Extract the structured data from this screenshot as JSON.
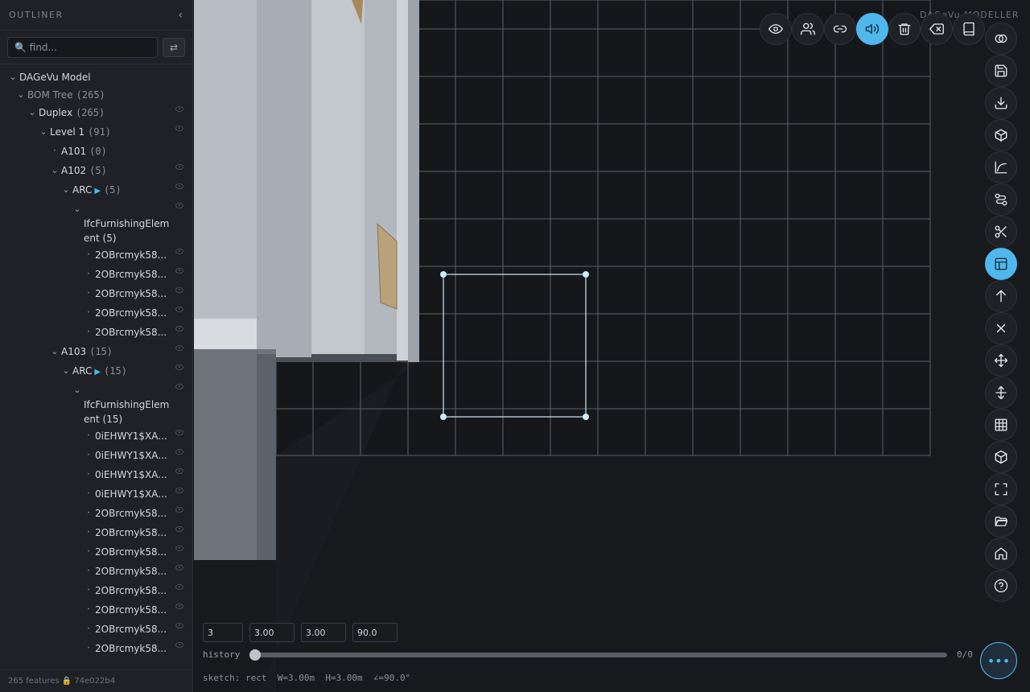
{
  "sidebar": {
    "title": "OUTLINER",
    "search_placeholder": "🔍 find...",
    "swap_icon": "⇄",
    "footer": "265 features 🔒 74e022b4"
  },
  "tree": [
    {
      "label": "DAGeVu Model",
      "count": "",
      "level": 0,
      "chev": true,
      "eye": false
    },
    {
      "label": "BOM Tree",
      "count": "(265)",
      "level": 1,
      "chev": true,
      "eye": false,
      "muted": true
    },
    {
      "label": "Duplex",
      "count": "(265)",
      "level": 2,
      "chev": true,
      "eye": true
    },
    {
      "label": "Level 1",
      "count": "(91)",
      "level": 3,
      "chev": true,
      "eye": true
    },
    {
      "label": "A101",
      "count": "(0)",
      "level": 4,
      "chev": false,
      "eye": false
    },
    {
      "label": "A102",
      "count": "(5)",
      "level": 4,
      "chev": true,
      "eye": true
    },
    {
      "label": "ARC",
      "count": "(5)",
      "level": 5,
      "chev": true,
      "eye": true,
      "arrow": true
    },
    {
      "label": "IfcFurnishingElement (5)",
      "count": "",
      "level": 6,
      "chev": true,
      "eye": true,
      "wrap": true
    },
    {
      "label": "2OBrcmyk58...",
      "count": "",
      "level": 7,
      "chev": false,
      "eye": true
    },
    {
      "label": "2OBrcmyk58...",
      "count": "",
      "level": 7,
      "chev": false,
      "eye": true
    },
    {
      "label": "2OBrcmyk58...",
      "count": "",
      "level": 7,
      "chev": false,
      "eye": true
    },
    {
      "label": "2OBrcmyk58...",
      "count": "",
      "level": 7,
      "chev": false,
      "eye": true
    },
    {
      "label": "2OBrcmyk58...",
      "count": "",
      "level": 7,
      "chev": false,
      "eye": true
    },
    {
      "label": "A103",
      "count": "(15)",
      "level": 4,
      "chev": true,
      "eye": true
    },
    {
      "label": "ARC",
      "count": "(15)",
      "level": 5,
      "chev": true,
      "eye": true,
      "arrow": true
    },
    {
      "label": "IfcFurnishingElement (15)",
      "count": "",
      "level": 6,
      "chev": true,
      "eye": true,
      "wrap": true
    },
    {
      "label": "0iEHWY1$XA...",
      "count": "",
      "level": 7,
      "chev": false,
      "eye": true
    },
    {
      "label": "0iEHWY1$XA...",
      "count": "",
      "level": 7,
      "chev": false,
      "eye": true
    },
    {
      "label": "0iEHWY1$XA...",
      "count": "",
      "level": 7,
      "chev": false,
      "eye": true
    },
    {
      "label": "0iEHWY1$XA...",
      "count": "",
      "level": 7,
      "chev": false,
      "eye": true
    },
    {
      "label": "2OBrcmyk58...",
      "count": "",
      "level": 7,
      "chev": false,
      "eye": true
    },
    {
      "label": "2OBrcmyk58...",
      "count": "",
      "level": 7,
      "chev": false,
      "eye": true
    },
    {
      "label": "2OBrcmyk58...",
      "count": "",
      "level": 7,
      "chev": false,
      "eye": true
    },
    {
      "label": "2OBrcmyk58...",
      "count": "",
      "level": 7,
      "chev": false,
      "eye": true
    },
    {
      "label": "2OBrcmyk58...",
      "count": "",
      "level": 7,
      "chev": false,
      "eye": true
    },
    {
      "label": "2OBrcmyk58...",
      "count": "",
      "level": 7,
      "chev": false,
      "eye": true
    },
    {
      "label": "2OBrcmyk58...",
      "count": "",
      "level": 7,
      "chev": false,
      "eye": true
    },
    {
      "label": "2OBrcmyk58...",
      "count": "",
      "level": 7,
      "chev": false,
      "eye": true
    }
  ],
  "viewport": {
    "brand": "DAGeVu MODELLER"
  },
  "top_toolbar": [
    "eye-icon",
    "users-icon",
    "link-icon",
    "volume-icon",
    "trash-icon",
    "backspace-icon",
    "book-icon"
  ],
  "right_toolbar": [
    "overlap-circles-icon",
    "save-icon",
    "download-icon",
    "box-icon",
    "curve-icon",
    "route-icon",
    "scissors-icon",
    "layout-icon",
    "arrow-up-icon",
    "close-icon",
    "move-icon",
    "split-vertical-icon",
    "grid-icon",
    "cube-icon",
    "fullscreen-icon",
    "folder-open-icon",
    "home-icon",
    "help-icon"
  ],
  "accent": "#4fb7ec",
  "controls": {
    "count": "3",
    "width": "3.00",
    "height": "3.00",
    "angle": "90.0",
    "history_label": "history",
    "history_count": "0/0",
    "history_position": 0,
    "status": "sketch: rect  W=3.00m  H=3.00m  ∠=90.0°",
    "more_icon": "•••"
  }
}
